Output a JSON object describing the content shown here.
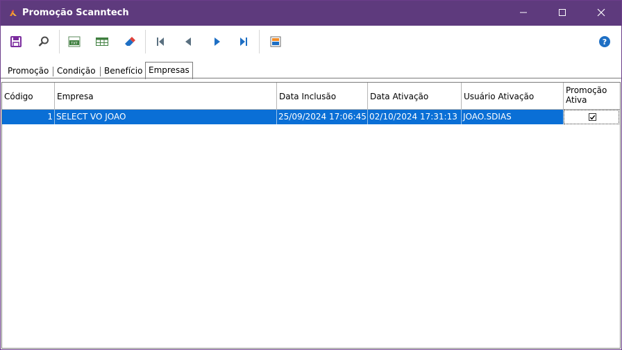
{
  "window": {
    "title": "Promoção Scanntech",
    "accent_color": "#5e3a7d",
    "icon": "scanntech-logo-icon"
  },
  "toolbar": {
    "buttons": [
      {
        "name": "save-button",
        "icon": "floppy-disk-icon"
      },
      {
        "name": "search-button",
        "icon": "magnifier-icon"
      },
      {
        "name": "export-txt-button",
        "icon": "txt-file-icon"
      },
      {
        "name": "grid-button",
        "icon": "table-grid-icon"
      },
      {
        "name": "clear-button",
        "icon": "eraser-icon"
      },
      {
        "name": "first-record-button",
        "icon": "skip-first-icon"
      },
      {
        "name": "previous-record-button",
        "icon": "triangle-left-icon"
      },
      {
        "name": "next-record-button",
        "icon": "triangle-right-icon"
      },
      {
        "name": "last-record-button",
        "icon": "skip-last-icon"
      },
      {
        "name": "log-button",
        "icon": "log-report-icon"
      },
      {
        "name": "help-button",
        "icon": "help-circle-icon"
      }
    ]
  },
  "tabs": [
    {
      "label": "Promoção",
      "active": false
    },
    {
      "label": "Condição",
      "active": false
    },
    {
      "label": "Benefício",
      "active": false
    },
    {
      "label": "Empresas",
      "active": true
    }
  ],
  "grid": {
    "columns": [
      "Código",
      "Empresa",
      "Data Inclusão",
      "Data Ativação",
      "Usuário Ativação",
      "Promoção Ativa"
    ],
    "rows": [
      {
        "codigo": "1",
        "empresa": "SELECT VO JOAO",
        "data_inclusao": "25/09/2024 17:06:45",
        "data_ativacao": "02/10/2024 17:31:13",
        "usuario_ativacao": "JOAO.SDIAS",
        "promocao_ativa": true,
        "selected": true
      }
    ],
    "selection_color": "#0a6fd6"
  }
}
